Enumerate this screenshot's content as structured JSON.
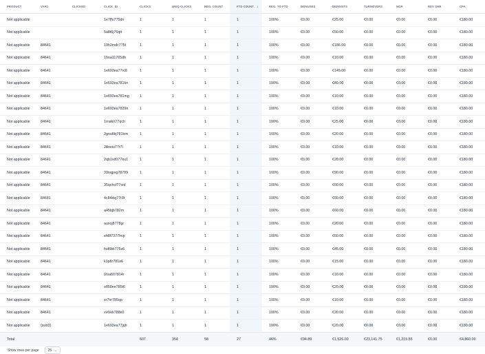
{
  "columns": [
    {
      "key": "product",
      "label": "PRODUCT"
    },
    {
      "key": "var",
      "label": "VAR1"
    },
    {
      "key": "clicked",
      "label": "CLICKED"
    },
    {
      "key": "click_id",
      "label": "CLICK_ID"
    },
    {
      "key": "clicks",
      "label": "CLICKS"
    },
    {
      "key": "uniq",
      "label": "UNIQ CLICKS"
    },
    {
      "key": "reg",
      "label": "REG. COUNT"
    },
    {
      "key": "ftd",
      "label": "FTD COUNT",
      "sort": "↓"
    },
    {
      "key": "regftd",
      "label": "REG. TO FTD"
    },
    {
      "key": "bonuses",
      "label": "BONUSES"
    },
    {
      "key": "deposits",
      "label": "DEPOSITS"
    },
    {
      "key": "turnovers",
      "label": "TURNOVERS"
    },
    {
      "key": "ngr",
      "label": "NGR"
    },
    {
      "key": "revshr",
      "label": "REV SHR"
    },
    {
      "key": "cpa",
      "label": "CPA"
    }
  ],
  "rows": [
    {
      "product": "Not applicable",
      "var": "",
      "clicked": "",
      "click_id": "1e7ffu775dn",
      "clicks": "1",
      "uniq": "1",
      "reg": "1",
      "ftd": "1",
      "regftd": "100%",
      "bonuses": "€0.00",
      "deposits": "€25.00",
      "turnovers": "€0.00",
      "ngr": "€0.00",
      "revshr": "€0.00",
      "cpa": "€180.00"
    },
    {
      "product": "Not applicable",
      "var": "",
      "clicked": "",
      "click_id": "5a8t6j76qtt",
      "clicks": "1",
      "uniq": "1",
      "reg": "1",
      "ftd": "1",
      "regftd": "100%",
      "bonuses": "€0.00",
      "deposits": "€50.00",
      "turnovers": "€0.00",
      "ngr": "€0.00",
      "revshr": "€0.00",
      "cpa": "€180.00"
    },
    {
      "product": "Not applicable",
      "var": "84641",
      "clicked": "",
      "click_id": "19h2mdc775t",
      "clicks": "1",
      "uniq": "1",
      "reg": "1",
      "ftd": "1",
      "regftd": "100%",
      "bonuses": "€0.00",
      "deposits": "€186.00",
      "turnovers": "€0.00",
      "ngr": "€0.00",
      "revshr": "€0.00",
      "cpa": "€180.00"
    },
    {
      "product": "Not applicable",
      "var": "84641",
      "clicked": "",
      "click_id": "1hna11765dh",
      "clicks": "1",
      "uniq": "1",
      "reg": "1",
      "ftd": "1",
      "regftd": "100%",
      "bonuses": "€0.00",
      "deposits": "€10.00",
      "turnovers": "€0.00",
      "ngr": "€0.00",
      "revshr": "€0.00",
      "cpa": "€180.00"
    },
    {
      "product": "Not applicable",
      "var": "84641",
      "clicked": "",
      "click_id": "1e693ea77rc8",
      "clicks": "1",
      "uniq": "1",
      "reg": "1",
      "ftd": "1",
      "regftd": "100%",
      "bonuses": "€0.00",
      "deposits": "€145.00",
      "turnovers": "€0.00",
      "ngr": "€0.00",
      "revshr": "€0.00",
      "cpa": "€180.00"
    },
    {
      "product": "Not applicable",
      "var": "84641",
      "clicked": "",
      "click_id": "1e693ea781kn",
      "clicks": "1",
      "uniq": "1",
      "reg": "1",
      "ftd": "1",
      "regftd": "100%",
      "bonuses": "€0.00",
      "deposits": "€40.00",
      "turnovers": "€0.00",
      "ngr": "€0.00",
      "revshr": "€0.00",
      "cpa": "€180.00"
    },
    {
      "product": "Not applicable",
      "var": "84641",
      "clicked": "",
      "click_id": "1e693ea781mg",
      "clicks": "1",
      "uniq": "1",
      "reg": "1",
      "ftd": "1",
      "regftd": "100%",
      "bonuses": "€0.00",
      "deposits": "€10.00",
      "turnovers": "€0.00",
      "ngr": "€0.00",
      "revshr": "€0.00",
      "cpa": "€180.00"
    },
    {
      "product": "Not applicable",
      "var": "84641",
      "clicked": "",
      "click_id": "1e693ea7839n",
      "clicks": "1",
      "uniq": "1",
      "reg": "1",
      "ftd": "1",
      "regftd": "100%",
      "bonuses": "€0.00",
      "deposits": "€10.00",
      "turnovers": "€0.00",
      "ngr": "€0.00",
      "revshr": "€0.00",
      "cpa": "€180.00"
    },
    {
      "product": "Not applicable",
      "var": "84641",
      "clicked": "",
      "click_id": "1rnakrt77qch",
      "clicks": "1",
      "uniq": "1",
      "reg": "1",
      "ftd": "1",
      "regftd": "100%",
      "bonuses": "€0.00",
      "deposits": "€25.00",
      "turnovers": "€0.00",
      "ngr": "€0.00",
      "revshr": "€0.00",
      "cpa": "€180.00"
    },
    {
      "product": "Not applicable",
      "var": "84641",
      "clicked": "",
      "click_id": "2gnu6kj781bm",
      "clicks": "1",
      "uniq": "1",
      "reg": "1",
      "ftd": "1",
      "regftd": "100%",
      "bonuses": "€0.00",
      "deposits": "€20.00",
      "turnovers": "€0.00",
      "ngr": "€0.00",
      "revshr": "€0.00",
      "cpa": "€180.00"
    },
    {
      "product": "Not applicable",
      "var": "84641",
      "clicked": "",
      "click_id": "28oeiu77r7l",
      "clicks": "1",
      "uniq": "1",
      "reg": "1",
      "ftd": "1",
      "regftd": "100%",
      "bonuses": "€0.00",
      "deposits": "€10.00",
      "turnovers": "€0.00",
      "ngr": "€0.00",
      "revshr": "€0.00",
      "cpa": "€180.00"
    },
    {
      "product": "Not applicable",
      "var": "84641",
      "clicked": "",
      "click_id": "2qh1vd077ou1",
      "clicks": "1",
      "uniq": "1",
      "reg": "1",
      "ftd": "1",
      "regftd": "100%",
      "bonuses": "€0.00",
      "deposits": "€20.00",
      "turnovers": "€0.00",
      "ngr": "€0.00",
      "revshr": "€0.00",
      "cpa": "€180.00"
    },
    {
      "product": "Not applicable",
      "var": "84641",
      "clicked": "",
      "click_id": "33nqpvg78799",
      "clicks": "1",
      "uniq": "1",
      "reg": "1",
      "ftd": "1",
      "regftd": "100%",
      "bonuses": "€0.00",
      "deposits": "€90.00",
      "turnovers": "€0.00",
      "ngr": "€0.00",
      "revshr": "€0.00",
      "cpa": "€180.00"
    },
    {
      "product": "Not applicable",
      "var": "84641",
      "clicked": "",
      "click_id": "35qchcf77oid",
      "clicks": "1",
      "uniq": "1",
      "reg": "1",
      "ftd": "1",
      "regftd": "100%",
      "bonuses": "€0.00",
      "deposits": "€60.00",
      "turnovers": "€0.00",
      "ngr": "€0.00",
      "revshr": "€0.00",
      "cpa": "€180.00"
    },
    {
      "product": "Not applicable",
      "var": "84641",
      "clicked": "",
      "click_id": "4c84dsj77r3t",
      "clicks": "1",
      "uniq": "1",
      "reg": "1",
      "ftd": "1",
      "regftd": "100%",
      "bonuses": "€0.00",
      "deposits": "€60.00",
      "turnovers": "€0.00",
      "ngr": "€0.00",
      "revshr": "€0.00",
      "cpa": "€180.00"
    },
    {
      "product": "Not applicable",
      "var": "84641",
      "clicked": "",
      "click_id": "a45bjb782m",
      "clicks": "1",
      "uniq": "1",
      "reg": "1",
      "ftd": "1",
      "regftd": "100%",
      "bonuses": "€0.00",
      "deposits": "€60.00",
      "turnovers": "€0.00",
      "ngr": "€0.00",
      "revshr": "€0.00",
      "cpa": "€180.00"
    },
    {
      "product": "Not applicable",
      "var": "84641",
      "clicked": "",
      "click_id": "auxoj8778gr",
      "clicks": "1",
      "uniq": "1",
      "reg": "1",
      "ftd": "1",
      "regftd": "100%",
      "bonuses": "€0.00",
      "deposits": "€20.00",
      "turnovers": "€0.00",
      "ngr": "€0.00",
      "revshr": "€0.00",
      "cpa": "€180.00"
    },
    {
      "product": "Not applicable",
      "var": "84641",
      "clicked": "",
      "click_id": "eh8f7377hvp",
      "clicks": "1",
      "uniq": "1",
      "reg": "1",
      "ftd": "1",
      "regftd": "100%",
      "bonuses": "€0.00",
      "deposits": "€60.00",
      "turnovers": "€0.00",
      "ngr": "€0.00",
      "revshr": "€0.00",
      "cpa": "€180.00"
    },
    {
      "product": "Not applicable",
      "var": "84641",
      "clicked": "",
      "click_id": "fcd6bk775s6",
      "clicks": "1",
      "uniq": "1",
      "reg": "1",
      "ftd": "1",
      "regftd": "100%",
      "bonuses": "€0.00",
      "deposits": "€45.00",
      "turnovers": "€0.00",
      "ngr": "€0.00",
      "revshr": "€0.00",
      "cpa": "€180.00"
    },
    {
      "product": "Not applicable",
      "var": "84641",
      "clicked": "",
      "click_id": "k3p8r781o6",
      "clicks": "1",
      "uniq": "1",
      "reg": "1",
      "ftd": "1",
      "regftd": "100%",
      "bonuses": "€0.00",
      "deposits": "€15.00",
      "turnovers": "€0.00",
      "ngr": "€0.00",
      "revshr": "€0.00",
      "cpa": "€180.00"
    },
    {
      "product": "Not applicable",
      "var": "84641",
      "clicked": "",
      "click_id": "l2oa607814r",
      "clicks": "1",
      "uniq": "1",
      "reg": "1",
      "ftd": "1",
      "regftd": "100%",
      "bonuses": "€0.00",
      "deposits": "€10.00",
      "turnovers": "€0.00",
      "ngr": "€0.00",
      "revshr": "€0.00",
      "cpa": "€180.00"
    },
    {
      "product": "Not applicable",
      "var": "84641",
      "clicked": "",
      "click_id": "o058ee785t6",
      "clicks": "1",
      "uniq": "1",
      "reg": "1",
      "ftd": "1",
      "regftd": "100%",
      "bonuses": "€0.00",
      "deposits": "€20.00",
      "turnovers": "€0.00",
      "ngr": "€0.00",
      "revshr": "€0.00",
      "cpa": "€180.00"
    },
    {
      "product": "Not applicable",
      "var": "84641",
      "clicked": "",
      "click_id": "sr7hr785qo",
      "clicks": "1",
      "uniq": "1",
      "reg": "1",
      "ftd": "1",
      "regftd": "100%",
      "bonuses": "€0.00",
      "deposits": "€10.00",
      "turnovers": "€0.00",
      "ngr": "€0.00",
      "revshr": "€0.00",
      "cpa": "€180.00"
    },
    {
      "product": "Not applicable",
      "var": "84641",
      "clicked": "",
      "click_id": "vv6ikk788e0",
      "clicks": "1",
      "uniq": "1",
      "reg": "1",
      "ftd": "1",
      "regftd": "100%",
      "bonuses": "€0.00",
      "deposits": "€20.00",
      "turnovers": "€0.00",
      "ngr": "€0.00",
      "revshr": "€0.00",
      "cpa": "€180.00"
    },
    {
      "product": "Not applicable",
      "var": "{sub3}",
      "clicked": "",
      "click_id": "1e693ea77jqh",
      "clicks": "1",
      "uniq": "1",
      "reg": "1",
      "ftd": "1",
      "regftd": "100%",
      "bonuses": "€0.00",
      "deposits": "€20.00",
      "turnovers": "€0.00",
      "ngr": "€0.00",
      "revshr": "€0.00",
      "cpa": "€180.00"
    }
  ],
  "totals": {
    "product": "Total",
    "var": "",
    "clicked": "",
    "click_id": "",
    "clicks": "607",
    "uniq": "354",
    "reg": "58",
    "ftd": "27",
    "regftd": "46%",
    "bonuses": "€94.89",
    "deposits": "€1,526.00",
    "turnovers": "€23,141.75",
    "ngr": "€1,215.55",
    "revshr": "€0.00",
    "cpa": "€4,860.00"
  },
  "pager": {
    "label": "Show rows per page",
    "value": "25",
    "icon": "chevron-down-icon"
  }
}
